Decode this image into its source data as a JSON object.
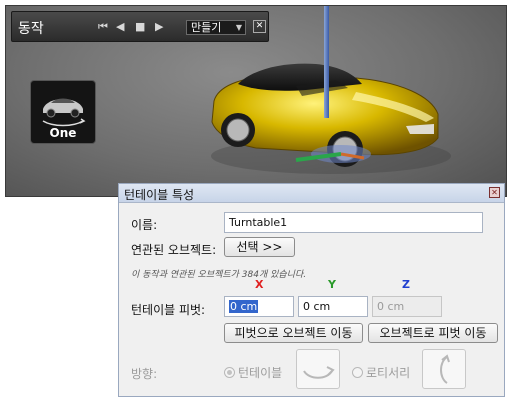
{
  "toolbar": {
    "title": "동작",
    "controls": [
      "⏮",
      "◀",
      "■",
      "▶"
    ],
    "select_value": "만들기",
    "close": "✕"
  },
  "viewport": {
    "thumbnail_label": "One"
  },
  "dialog": {
    "title": "턴테이블 특성",
    "close": "✕",
    "name_label": "이름:",
    "name_value": "Turntable1",
    "linked_label": "연관된 오브젝트:",
    "select_button": "선택 >>",
    "note": "이 동작과 연관된 오브젝트가 384개 있습니다.",
    "axis_x": "X",
    "axis_y": "Y",
    "axis_z": "Z",
    "pivot_label": "턴테이블 피벗:",
    "pivot_x": "0 cm",
    "pivot_y": "0 cm",
    "pivot_z": "0 cm",
    "move_object_button": "피벗으로 오브젝트 이동",
    "move_pivot_button": "오브젝트로 피벗 이동",
    "direction_label": "방향:",
    "option_turntable": "턴테이블",
    "option_rotisserie": "로티서리"
  },
  "colors": {
    "axis_x": "#e02020",
    "axis_y": "#2a9a2a",
    "axis_z": "#2040d0",
    "car_body": "#d8b800",
    "selection": "#3366cc"
  }
}
